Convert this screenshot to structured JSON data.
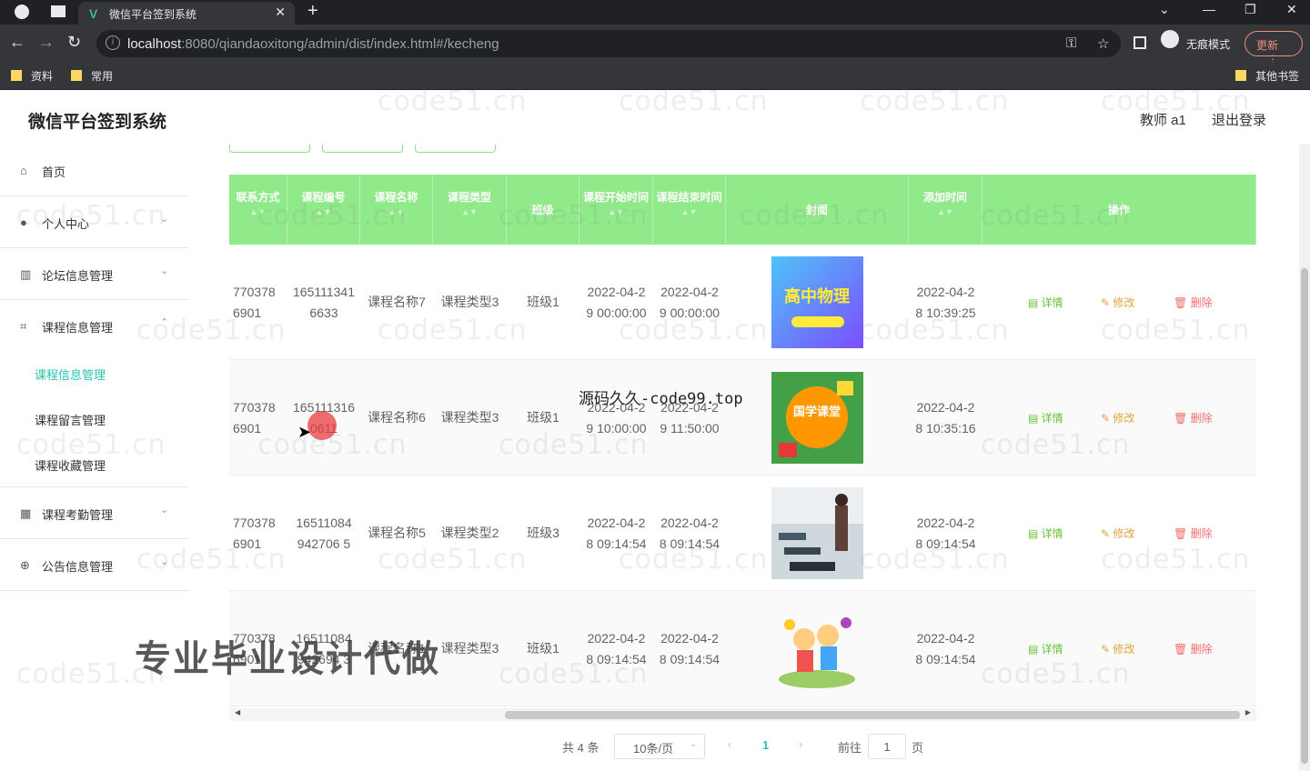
{
  "browser": {
    "tab_title": "微信平台签到系统",
    "url_host": "localhost",
    "url_rest": ":8080/qiandaoxitong/admin/dist/index.html#/kecheng",
    "incognito_label": "无痕模式",
    "update_label": "更新",
    "bookmarks": [
      "资料",
      "常用"
    ],
    "other_bookmarks": "其他书签"
  },
  "header": {
    "title": "微信平台签到系统",
    "user": "教师 a1",
    "logout": "退出登录"
  },
  "sidebar": {
    "items": [
      {
        "label": "首页",
        "icon": "home-icon"
      },
      {
        "label": "个人中心",
        "icon": "user-icon"
      },
      {
        "label": "论坛信息管理",
        "icon": "chart-icon"
      },
      {
        "label": "课程信息管理",
        "icon": "crop-icon"
      },
      {
        "label": "课程考勤管理",
        "icon": "grid-icon"
      },
      {
        "label": "公告信息管理",
        "icon": "globe-icon"
      }
    ],
    "sub_items": [
      "课程信息管理",
      "课程留言管理",
      "课程收藏管理"
    ]
  },
  "table": {
    "headers": [
      "联系方式",
      "课程编号",
      "课程名称",
      "课程类型",
      "班级",
      "课程开始时间",
      "课程结束时间",
      "封面",
      "添加时间",
      "操作"
    ],
    "rows": [
      {
        "contact": "7703786901",
        "code": "1651113416633",
        "name": "课程名称7",
        "type": "课程类型3",
        "class": "班级1",
        "start": "2022-04-29 00:00:00",
        "end": "2022-04-29 00:00:00",
        "cover": "高中物理",
        "added": "2022-04-28 10:39:25"
      },
      {
        "contact": "7703786901",
        "code": "1651113160611",
        "name": "课程名称6",
        "type": "课程类型3",
        "class": "班级1",
        "start": "2022-04-29 10:00:00",
        "end": "2022-04-29 11:50:00",
        "cover": "国学课堂",
        "added": "2022-04-28 10:35:16"
      },
      {
        "contact": "7703786901",
        "code": "16511084942706 5",
        "name": "课程名称5",
        "type": "课程类型2",
        "class": "班级3",
        "start": "2022-04-28 09:14:54",
        "end": "2022-04-28 09:14:54",
        "cover": "classroom",
        "added": "2022-04-28 09:14:54"
      },
      {
        "contact": "7703786901",
        "code": "16511084942694 3",
        "name": "课程名称1",
        "type": "课程类型3",
        "class": "班级1",
        "start": "2022-04-28 09:14:54",
        "end": "2022-04-28 09:14:54",
        "cover": "children",
        "added": "2022-04-28 09:14:54"
      }
    ],
    "ops": {
      "detail": "详情",
      "edit": "修改",
      "delete": "删除"
    }
  },
  "pagination": {
    "total": "共 4 条",
    "page_size": "10条/页",
    "current": "1",
    "goto_prefix": "前往",
    "goto_value": "1",
    "goto_suffix": "页"
  },
  "overlays": {
    "source_text": "源码久久-code99.top",
    "promo_text": "专业毕业设计代做",
    "watermark": "code51.cn"
  },
  "colors": {
    "header_green": "#90ea8a",
    "accent_teal": "#26c6b0",
    "detail_green": "#67c23a",
    "edit_orange": "#e6a23c",
    "delete_red": "#f56c6c"
  }
}
